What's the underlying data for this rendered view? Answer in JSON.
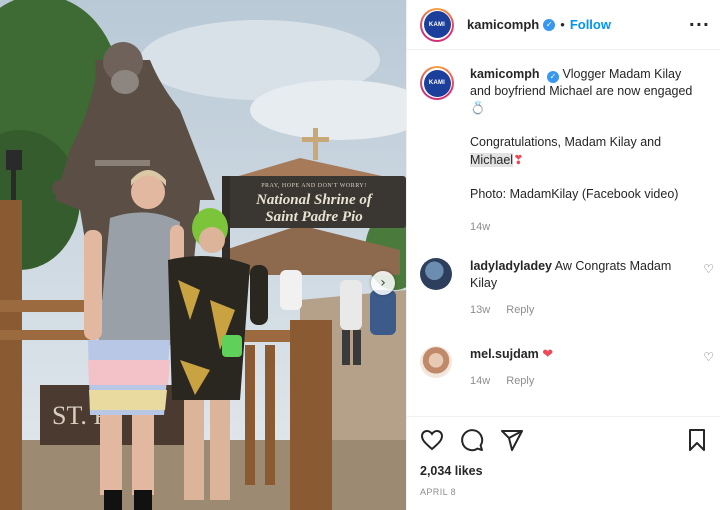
{
  "post": {
    "username": "kamicomph",
    "verified_icon": "verified-badge-icon",
    "separator": "•",
    "follow_label": "Follow",
    "more_icon": "more-options-icon",
    "avatar_text": "KAMI"
  },
  "photo": {
    "sign_line1": "PRAY, HOPE AND DON'T WORRY!",
    "sign_line2": "National Shrine of",
    "sign_line3": "Saint Padre Pio",
    "plaque_text": "ST. PI",
    "next_icon": "chevron-right-icon",
    "next_glyph": "›"
  },
  "caption": {
    "username": "kamicomph",
    "text_line1": "Vlogger Madam Kilay and boyfriend Michael are now engaged",
    "text_emoji": "💍",
    "congrats_prefix": "Congratulations, Madam Kilay and",
    "congrats_name": "Michael",
    "congrats_emoji": "❣",
    "photo_credit": "Photo: MadamKilay (Facebook video)",
    "age": "14w"
  },
  "comments": [
    {
      "username": "ladyladyladey",
      "text": "Aw Congrats Madam Kilay",
      "age": "13w",
      "reply_label": "Reply",
      "like_icon": "heart-outline-icon",
      "like_glyph": "♡"
    },
    {
      "username": "mel.sujdam",
      "text": "❤",
      "age": "14w",
      "reply_label": "Reply",
      "like_icon": "heart-outline-icon",
      "like_glyph": "♡"
    }
  ],
  "actions": {
    "icons": [
      "heart-outline-icon",
      "comment-icon",
      "share-icon",
      "bookmark-icon"
    ],
    "likes": "2,034 likes",
    "date": "APRIL 8"
  },
  "colors": {
    "accent_blue": "#0095f6",
    "verified_blue": "#3897f0",
    "muted_text": "#8e8e8e",
    "heart_red": "#ed4956"
  }
}
